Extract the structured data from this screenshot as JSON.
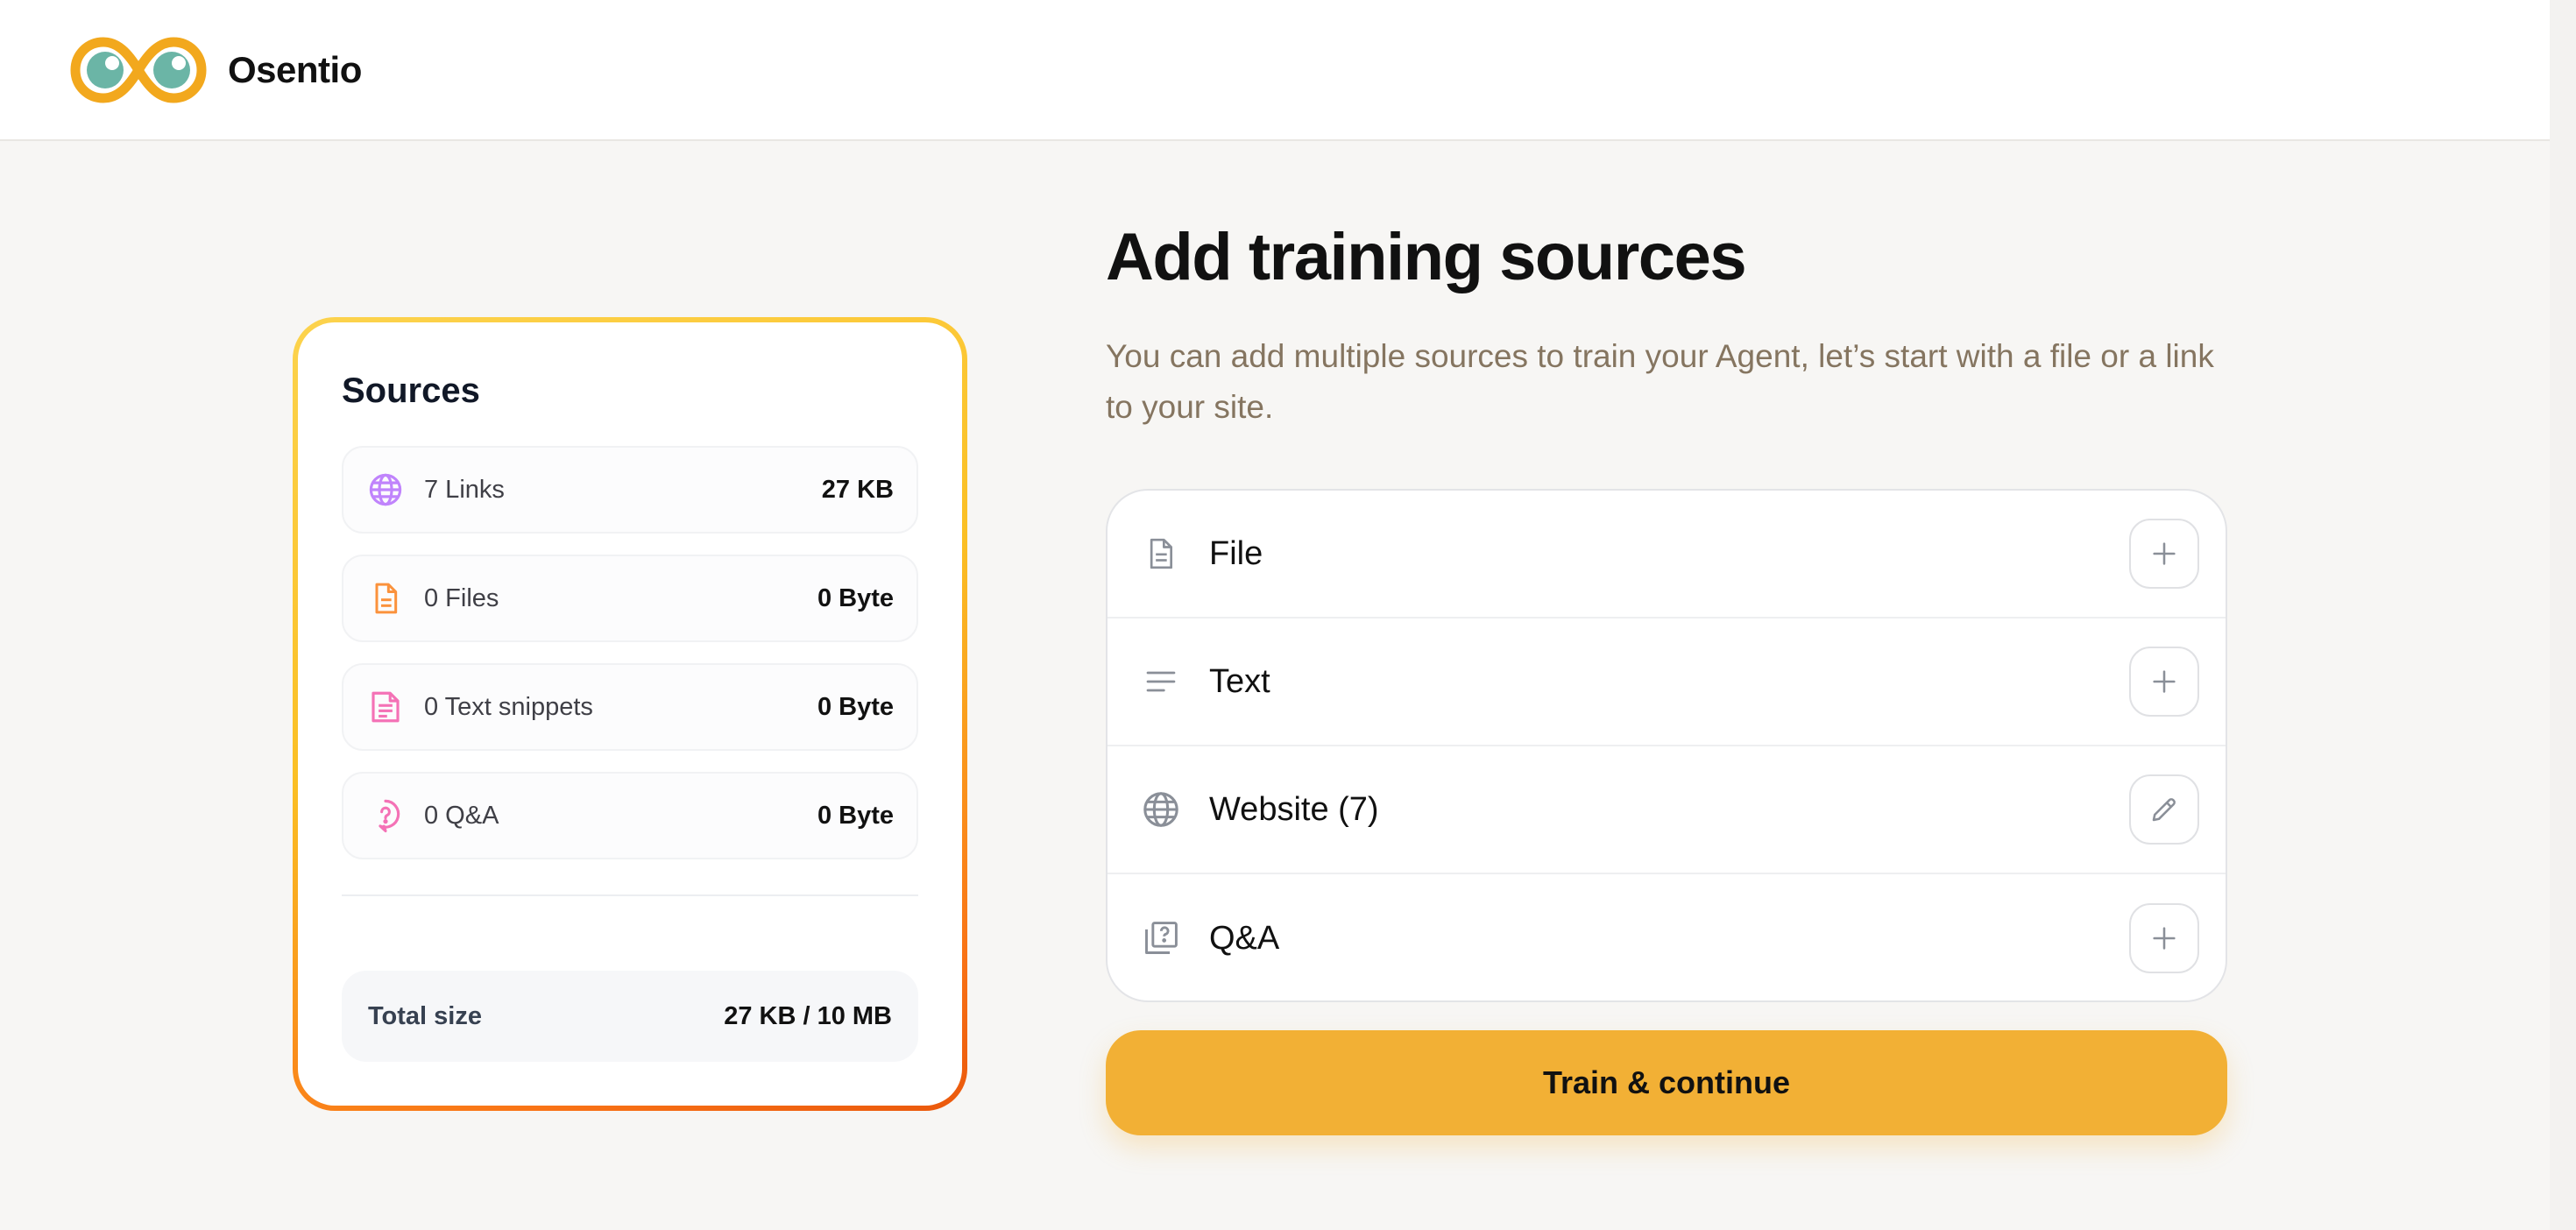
{
  "brand": {
    "name": "Osentio"
  },
  "sources": {
    "title": "Sources",
    "items": [
      {
        "label": "7 Links",
        "value": "27 KB",
        "icon": "globe-icon",
        "color": "#c084fc"
      },
      {
        "label": "0 Files",
        "value": "0 Byte",
        "icon": "file-icon",
        "color": "#fb923c"
      },
      {
        "label": "0 Text snippets",
        "value": "0 Byte",
        "icon": "text-file-icon",
        "color": "#f472b6"
      },
      {
        "label": "0 Q&A",
        "value": "0 Byte",
        "icon": "question-icon",
        "color": "#f472b6"
      }
    ],
    "total": {
      "label": "Total size",
      "value": "27 KB / 10 MB"
    }
  },
  "main": {
    "title": "Add training sources",
    "subtitle": "You can add multiple sources to train your Agent, let’s start with a file or a link to your site.",
    "options": [
      {
        "label": "File",
        "icon": "file-icon",
        "action": "add"
      },
      {
        "label": "Text",
        "icon": "text-lines-icon",
        "action": "add"
      },
      {
        "label": "Website (7)",
        "icon": "globe-icon",
        "action": "edit"
      },
      {
        "label": "Q&A",
        "icon": "qa-icon",
        "action": "add"
      }
    ],
    "cta": "Train & continue"
  },
  "colors": {
    "accent": "#f2b035",
    "logo_orange": "#f2a81d",
    "logo_teal": "#6bb5a6"
  }
}
